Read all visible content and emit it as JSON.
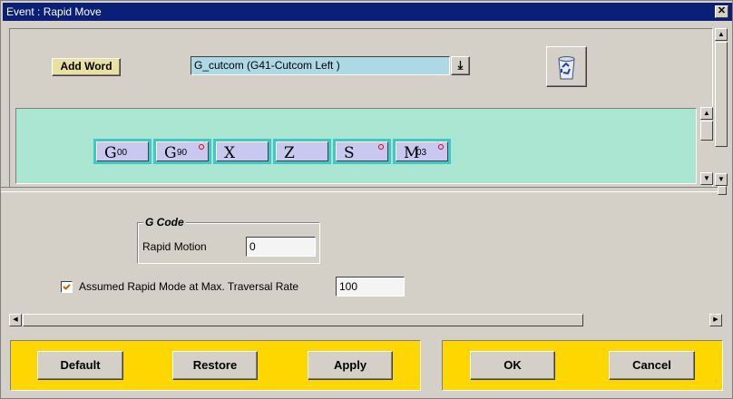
{
  "window": {
    "title": "Event : Rapid Move",
    "close_label": "✕"
  },
  "editor": {
    "add_word_label": "Add Word",
    "word_select_value": "G_cutcom (G41-Cutcom Left )",
    "word_select_arrow": "⤓",
    "words": [
      {
        "letter": "G",
        "sub": "00",
        "optional": false
      },
      {
        "letter": "G",
        "sub": "90",
        "optional": true
      },
      {
        "letter": "X",
        "sub": "",
        "optional": false
      },
      {
        "letter": "Z",
        "sub": "",
        "optional": false
      },
      {
        "letter": "S",
        "sub": "",
        "optional": true
      },
      {
        "letter": "M",
        "sub": "03",
        "optional": true
      }
    ]
  },
  "settings": {
    "group_title": "G Code",
    "rapid_motion_label": "Rapid Motion",
    "rapid_motion_value": "0",
    "assume_label": "Assumed Rapid Mode at Max. Traversal Rate",
    "assume_checked": true,
    "traversal_value": "100"
  },
  "buttons": {
    "default_label": "Default",
    "restore_label": "Restore",
    "apply_label": "Apply",
    "ok_label": "OK",
    "cancel_label": "Cancel"
  },
  "colors": {
    "title_bar": "#0a1f78",
    "word_strip": "#abe6d2",
    "word_face": "#c8c8f0",
    "button_bar": "#ffd700",
    "dropdown": "#add8e6"
  }
}
